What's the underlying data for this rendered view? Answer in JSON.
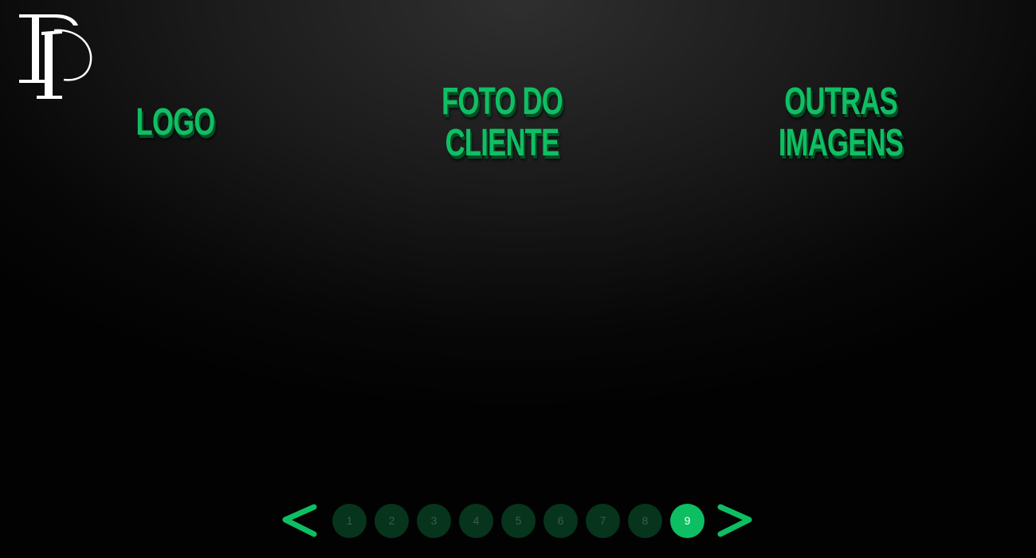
{
  "brand": {
    "logo_icon": "dp-monogram-logo",
    "accent_color": "#0fbf63"
  },
  "headings": {
    "logo": "LOGO",
    "foto_line1": "FOTO DO",
    "foto_line2": "CLIENTE",
    "outras_line1": "OUTRAS",
    "outras_line2": "IMAGENS"
  },
  "pagination": {
    "prev_icon": "chevron-left-icon",
    "next_icon": "chevron-right-icon",
    "pages": [
      "1",
      "2",
      "3",
      "4",
      "5",
      "6",
      "7",
      "8",
      "9"
    ],
    "active_page": "9"
  }
}
